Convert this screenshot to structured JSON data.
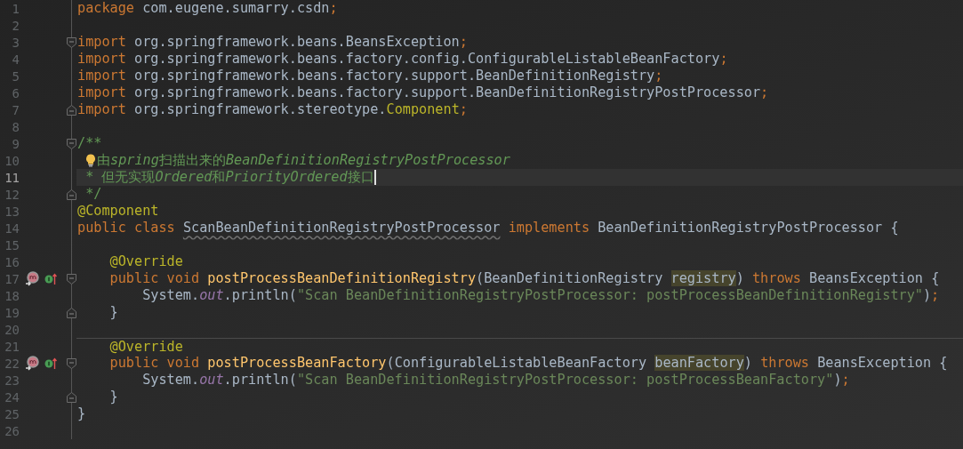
{
  "editor": {
    "lines": [
      {
        "number": "1",
        "tokens": [
          {
            "text": "package",
            "kind": "keyword"
          },
          {
            "text": " com.eugene.sumarry.csdn",
            "kind": "plain"
          },
          {
            "text": ";",
            "kind": "punct"
          }
        ]
      },
      {
        "number": "2"
      },
      {
        "number": "3",
        "fold_open": true,
        "tokens": [
          {
            "text": "import",
            "kind": "keyword"
          },
          {
            "text": " org.springframework.beans.BeansException",
            "kind": "plain"
          },
          {
            "text": ";",
            "kind": "punct"
          }
        ]
      },
      {
        "number": "4",
        "tokens": [
          {
            "text": "import",
            "kind": "keyword"
          },
          {
            "text": " org.springframework.beans.factory.config.ConfigurableListableBeanFactory",
            "kind": "plain"
          },
          {
            "text": ";",
            "kind": "punct"
          }
        ]
      },
      {
        "number": "5",
        "tokens": [
          {
            "text": "import",
            "kind": "keyword"
          },
          {
            "text": " org.springframework.beans.factory.support.BeanDefinitionRegistry",
            "kind": "plain"
          },
          {
            "text": ";",
            "kind": "punct"
          }
        ]
      },
      {
        "number": "6",
        "tokens": [
          {
            "text": "import",
            "kind": "keyword"
          },
          {
            "text": " org.springframework.beans.factory.support.BeanDefinitionRegistryPostProcessor",
            "kind": "plain"
          },
          {
            "text": ";",
            "kind": "punct"
          }
        ]
      },
      {
        "number": "7",
        "fold_close": true,
        "tokens": [
          {
            "text": "import",
            "kind": "keyword"
          },
          {
            "text": " org.springframework.stereotype.",
            "kind": "plain"
          },
          {
            "text": "Component",
            "kind": "annotation"
          },
          {
            "text": ";",
            "kind": "punct"
          }
        ]
      },
      {
        "number": "8"
      },
      {
        "number": "9",
        "fold_open": true,
        "tokens": [
          {
            "text": "/**",
            "kind": "doc"
          }
        ]
      },
      {
        "number": "10",
        "bulb": true,
        "tokens": [
          {
            "text": "由",
            "kind": "doc"
          },
          {
            "text": "spring",
            "kind": "doc-italic"
          },
          {
            "text": "扫描出来的",
            "kind": "doc"
          },
          {
            "text": "BeanDefinitionRegistryPostProcessor",
            "kind": "doc-italic"
          }
        ]
      },
      {
        "number": "11",
        "current": true,
        "caret": true,
        "tokens": [
          {
            "text": " * 但无实现",
            "kind": "doc"
          },
          {
            "text": "Ordered",
            "kind": "doc-italic"
          },
          {
            "text": "和",
            "kind": "doc"
          },
          {
            "text": "PriorityOrdered",
            "kind": "doc-italic"
          },
          {
            "text": "接口",
            "kind": "doc"
          }
        ]
      },
      {
        "number": "12",
        "fold_close": true,
        "tokens": [
          {
            "text": " */",
            "kind": "doc"
          }
        ]
      },
      {
        "number": "13",
        "tokens": [
          {
            "text": "@Component",
            "kind": "annotation"
          }
        ]
      },
      {
        "number": "14",
        "tokens": [
          {
            "text": "public class ",
            "kind": "keyword"
          },
          {
            "text": "ScanBeanDefinitionRegistryPostProcessor",
            "kind": "unused"
          },
          {
            "text": " implements",
            "kind": "keyword"
          },
          {
            "text": " BeanDefinitionRegistryPostProcessor {",
            "kind": "plain"
          }
        ]
      },
      {
        "number": "15"
      },
      {
        "number": "16",
        "tokens": [
          {
            "text": "    @Override",
            "kind": "annotation"
          }
        ]
      },
      {
        "number": "17",
        "implements_marker": true,
        "fold_open": true,
        "tokens": [
          {
            "text": "    public void ",
            "kind": "keyword"
          },
          {
            "text": "postProcessBeanDefinitionRegistry",
            "kind": "method"
          },
          {
            "text": "(BeanDefinitionRegistry ",
            "kind": "plain"
          },
          {
            "text": "registry",
            "kind": "highlight"
          },
          {
            "text": ") ",
            "kind": "plain"
          },
          {
            "text": "throws",
            "kind": "keyword"
          },
          {
            "text": " BeansException {",
            "kind": "plain"
          }
        ]
      },
      {
        "number": "18",
        "tokens": [
          {
            "text": "        System.",
            "kind": "plain"
          },
          {
            "text": "out",
            "kind": "static"
          },
          {
            "text": ".println(",
            "kind": "plain"
          },
          {
            "text": "\"Scan BeanDefinitionRegistryPostProcessor: postProcessBeanDefinitionRegistry\"",
            "kind": "string"
          },
          {
            "text": ")",
            "kind": "plain"
          },
          {
            "text": ";",
            "kind": "punct"
          }
        ]
      },
      {
        "number": "19",
        "fold_close": true,
        "tokens": [
          {
            "text": "    }",
            "kind": "plain"
          }
        ]
      },
      {
        "number": "20"
      },
      {
        "number": "21",
        "separator": true,
        "tokens": [
          {
            "text": "    @Override",
            "kind": "annotation"
          }
        ]
      },
      {
        "number": "22",
        "implements_marker": true,
        "fold_open": true,
        "tokens": [
          {
            "text": "    public void ",
            "kind": "keyword"
          },
          {
            "text": "postProcessBeanFactory",
            "kind": "method"
          },
          {
            "text": "(ConfigurableListableBeanFactory ",
            "kind": "plain"
          },
          {
            "text": "beanFactory",
            "kind": "highlight"
          },
          {
            "text": ") ",
            "kind": "plain"
          },
          {
            "text": "throws",
            "kind": "keyword"
          },
          {
            "text": " BeansException {",
            "kind": "plain"
          }
        ]
      },
      {
        "number": "23",
        "tokens": [
          {
            "text": "        System.",
            "kind": "plain"
          },
          {
            "text": "out",
            "kind": "static"
          },
          {
            "text": ".println(",
            "kind": "plain"
          },
          {
            "text": "\"Scan BeanDefinitionRegistryPostProcessor: postProcessBeanFactory\"",
            "kind": "string"
          },
          {
            "text": ")",
            "kind": "plain"
          },
          {
            "text": ";",
            "kind": "punct"
          }
        ]
      },
      {
        "number": "24",
        "fold_close": true,
        "tokens": [
          {
            "text": "    }",
            "kind": "plain"
          }
        ]
      },
      {
        "number": "25",
        "tokens": [
          {
            "text": "}",
            "kind": "plain"
          }
        ]
      },
      {
        "number": "26"
      }
    ]
  }
}
